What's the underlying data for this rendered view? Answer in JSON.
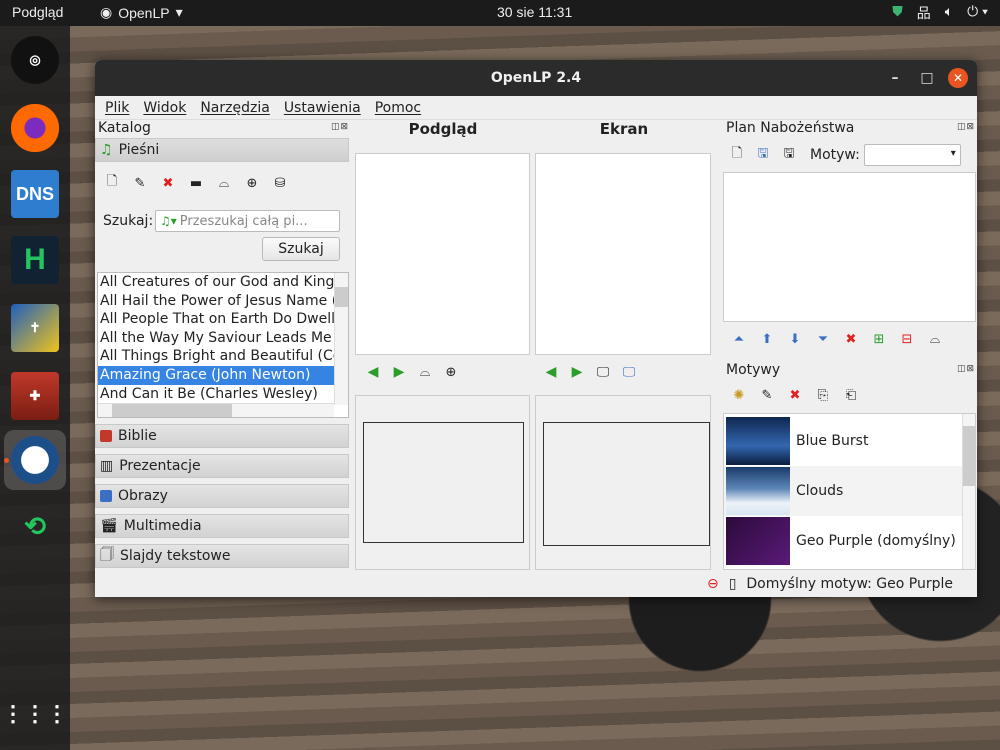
{
  "topbar": {
    "activities": "Podgląd",
    "app_name": "OpenLP",
    "clock": "30 sie  11:31"
  },
  "dock": {
    "dns_label": "DNS",
    "h_label": "H"
  },
  "window": {
    "title": "OpenLP 2.4"
  },
  "menu": [
    "Plik",
    "Widok",
    "Narzędzia",
    "Ustawienia",
    "Pomoc"
  ],
  "library": {
    "title": "Katalog",
    "songs_section": "Pieśni",
    "search_label": "Szukaj:",
    "search_placeholder": "Przeszukaj całą pi...",
    "search_button": "Szukaj",
    "songs": [
      "All Creatures of our God and King (S",
      "All Hail the Power of Jesus Name (E",
      "All People That on Earth Do Dwell (",
      "All the Way My Saviour Leads Me (Fa",
      "All Things Bright and Beautiful (Cec",
      "Amazing Grace (John Newton)",
      "And Can it Be (Charles Wesley)"
    ],
    "selected_song": "Amazing Grace (John Newton)",
    "sections": [
      "Biblie",
      "Prezentacje",
      "Obrazy",
      "Multimedia",
      "Slajdy tekstowe"
    ]
  },
  "preview": {
    "title": "Podgląd"
  },
  "live": {
    "title": "Ekran"
  },
  "service": {
    "title": "Plan Nabożeństwa",
    "theme_label": "Motyw:",
    "theme_value": ""
  },
  "themes": {
    "title": "Motywy",
    "items": [
      "Blue Burst",
      "Clouds",
      "Geo Purple (domyślny)"
    ]
  },
  "status": {
    "default_theme": "Domyślny motyw: Geo Purple"
  }
}
